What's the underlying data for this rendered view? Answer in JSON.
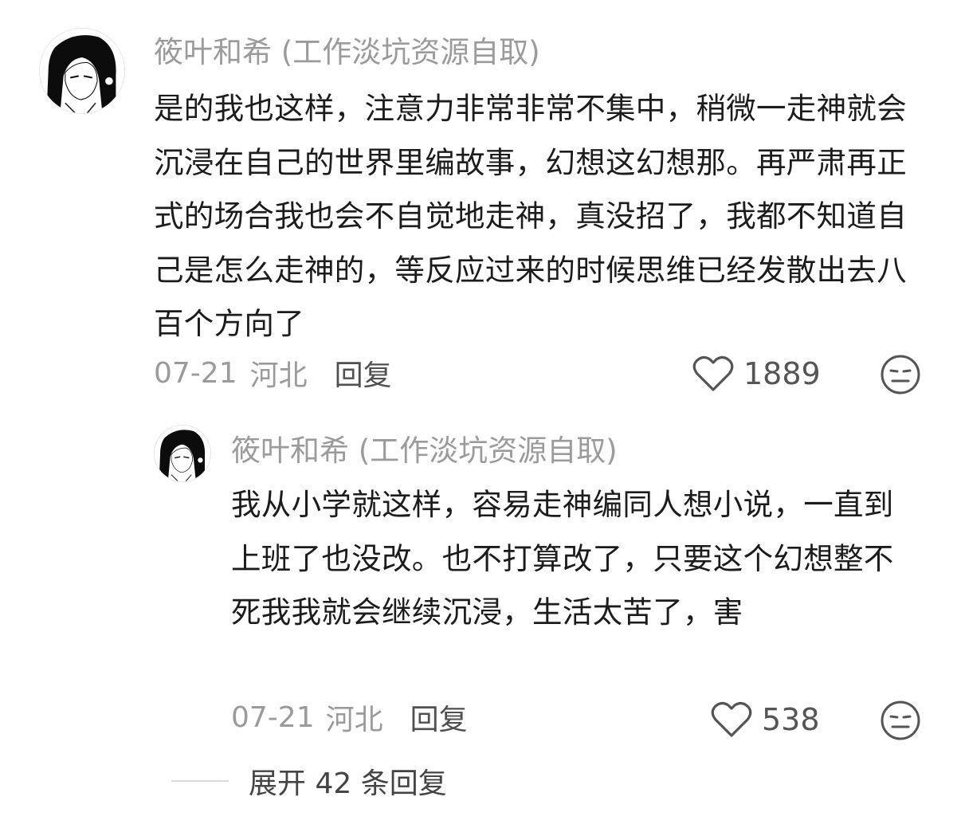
{
  "comments": [
    {
      "username": "筱叶和希 (工作淡坑资源自取)",
      "text": "是的我也这样，注意力非常非常不集中，稍微一走神就会沉浸在自己的世界里编故事，幻想这幻想那。再严肃再正式的场合我也会不自觉地走神，真没招了，我都不知道自己是怎么走神的，等反应过来的时候思维已经发散出去八百个方向了",
      "date": "07-21",
      "location": "河北",
      "reply_label": "回复",
      "likes": "1889",
      "avatar_icon": "anime-avatar-icon",
      "like_icon": "heart-outline-icon",
      "react_icon": "expressionless-face-icon"
    },
    {
      "username": "筱叶和希 (工作淡坑资源自取)",
      "text": "我从小学就这样，容易走神编同人想小说，一直到上班了也没改。也不打算改了，只要这个幻想整不死我我就会继续沉浸，生活太苦了，害",
      "date": "07-21",
      "location": "河北",
      "reply_label": "回复",
      "likes": "538",
      "avatar_icon": "anime-avatar-icon",
      "like_icon": "heart-outline-icon",
      "react_icon": "expressionless-face-icon"
    }
  ],
  "expand_replies": {
    "label": "展开 42 条回复"
  },
  "colors": {
    "secondary_text": "#9b9b9b",
    "primary_text": "#1c1c1c",
    "reply": "#505050",
    "divider": "#dcdcdc"
  }
}
